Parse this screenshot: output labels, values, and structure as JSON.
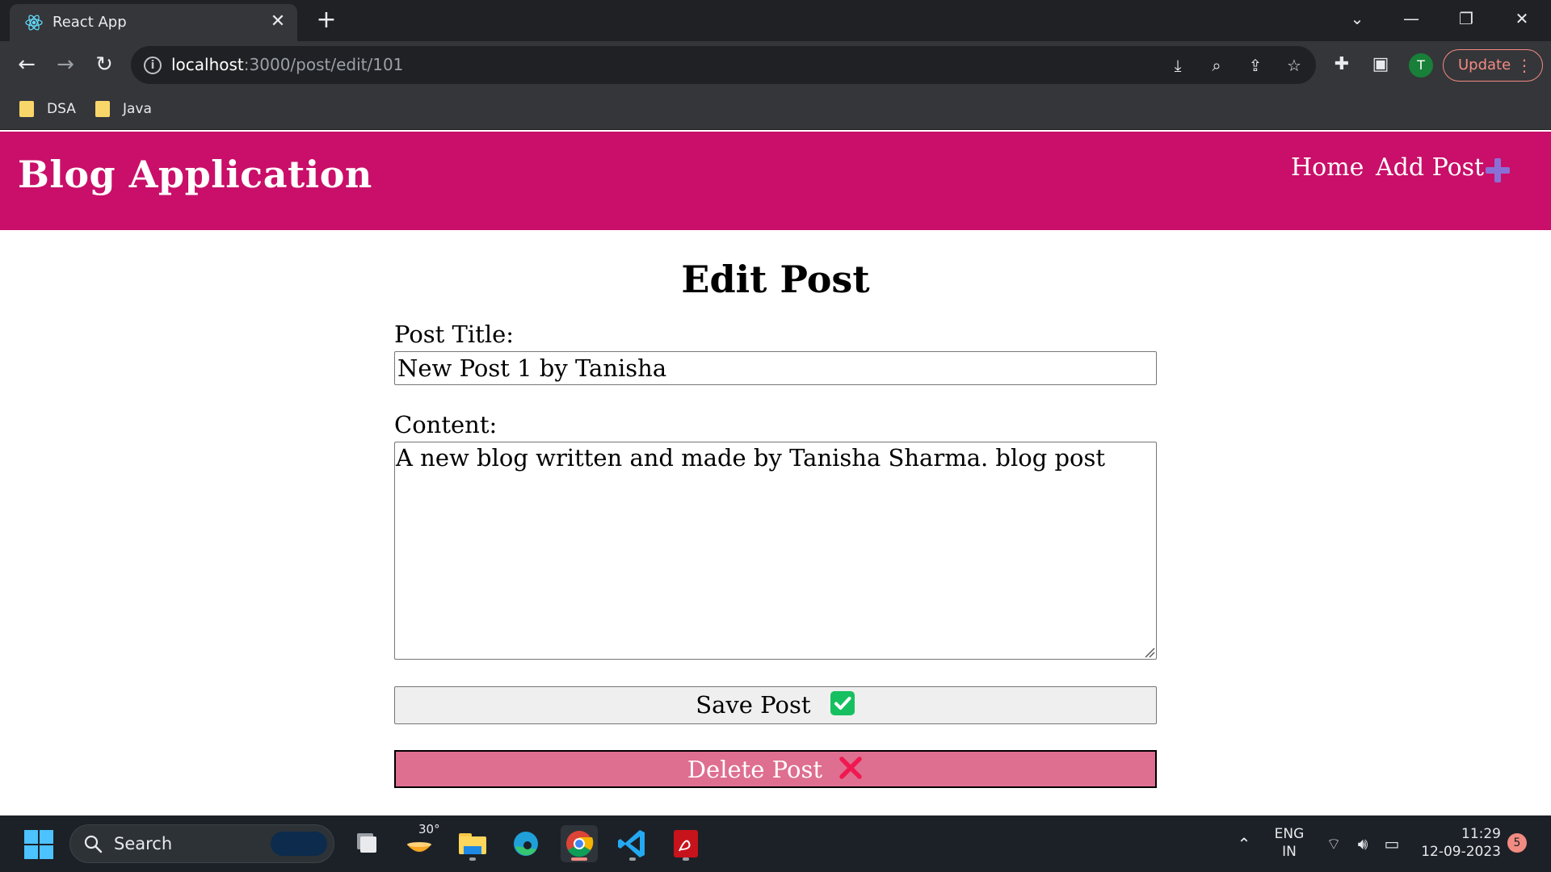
{
  "browser": {
    "tab_title": "React App",
    "url_host": "localhost",
    "url_path": ":3000/post/edit/101",
    "update_label": "Update",
    "profile_initial": "T",
    "bookmarks": [
      {
        "label": "DSA"
      },
      {
        "label": "Java"
      }
    ]
  },
  "app": {
    "brand": "Blog Application",
    "nav": {
      "home": "Home",
      "add_post": "Add Post"
    }
  },
  "form": {
    "page_title": "Edit Post",
    "title_label": "Post Title:",
    "title_value": "New Post 1 by Tanisha",
    "content_label": "Content:",
    "content_value": "A new blog written and made by Tanisha Sharma. blog post",
    "save_label": "Save Post",
    "delete_label": "Delete Post"
  },
  "taskbar": {
    "search_placeholder": "Search",
    "weather_temp": "30°",
    "lang_line1": "ENG",
    "lang_line2": "IN",
    "time": "11:29",
    "date": "12-09-2023",
    "notification_count": "5"
  },
  "colors": {
    "header_bg": "#c90f69",
    "delete_bg": "#de6f90",
    "check_green": "#16c060",
    "x_red": "#f0194f",
    "plus_purple": "#8a70d6"
  }
}
